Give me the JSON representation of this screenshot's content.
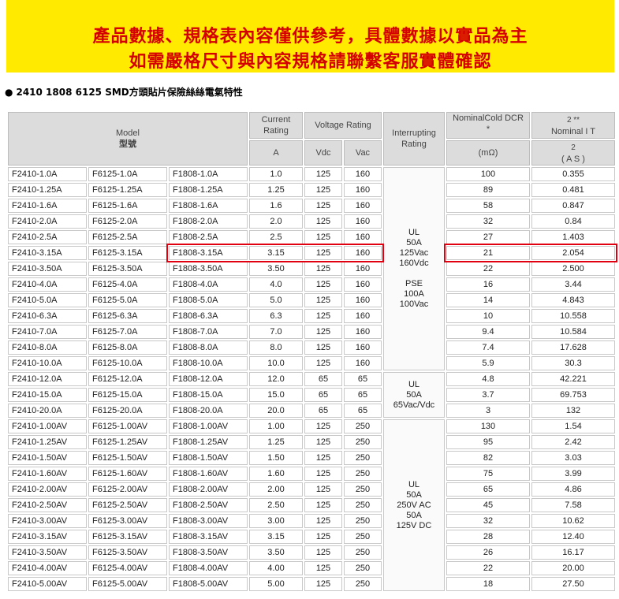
{
  "banner": {
    "line1": "產品數據、規格表內容僅供參考，具體數據以實品為主",
    "line2": "如需嚴格尺寸與內容規格請聯繫客服實體確認",
    "bg": "#ffea00",
    "color": "#d50000"
  },
  "section_title": "2410 1808 6125 SMD方頭貼片保險絲絲電氣特性",
  "header": {
    "model": "Model",
    "model_zh": "型號",
    "current_rating": "Current Rating",
    "voltage_rating": "Voltage Rating",
    "interrupting_rating": "Interrupting Rating",
    "nominal_dcr": "NominalCold DCR *",
    "nominal_i2t_top": "2 **",
    "nominal_i2t": "Nominal I T",
    "unit_a": "A",
    "unit_vdc": "Vdc",
    "unit_vac": "Vac",
    "unit_mohm": "(mΩ)",
    "unit_i2t_top": "2",
    "unit_i2t": "( A S )"
  },
  "interrupting": [
    {
      "text": "UL\n50A\n125Vac\n160Vdc\n\nPSE\n100A\n100Vac"
    },
    {
      "text": "UL\n50A\n65Vac/Vdc"
    },
    {
      "text": "UL\n50A\n250V AC\n50A\n125V DC"
    }
  ],
  "rows": [
    {
      "m2410": "F2410-1.0A",
      "m6125": "F6125-1.0A",
      "m1808": "F1808-1.0A",
      "a": "1.0",
      "vdc": "125",
      "vac": "160",
      "dcr": "100",
      "i2t": "0.355"
    },
    {
      "m2410": "F2410-1.25A",
      "m6125": "F6125-1.25A",
      "m1808": "F1808-1.25A",
      "a": "1.25",
      "vdc": "125",
      "vac": "160",
      "dcr": "89",
      "i2t": "0.481"
    },
    {
      "m2410": "F2410-1.6A",
      "m6125": "F6125-1.6A",
      "m1808": "F1808-1.6A",
      "a": "1.6",
      "vdc": "125",
      "vac": "160",
      "dcr": "58",
      "i2t": "0.847"
    },
    {
      "m2410": "F2410-2.0A",
      "m6125": "F6125-2.0A",
      "m1808": "F1808-2.0A",
      "a": "2.0",
      "vdc": "125",
      "vac": "160",
      "dcr": "32",
      "i2t": "0.84"
    },
    {
      "m2410": "F2410-2.5A",
      "m6125": "F6125-2.5A",
      "m1808": "F1808-2.5A",
      "a": "2.5",
      "vdc": "125",
      "vac": "160",
      "dcr": "27",
      "i2t": "1.403"
    },
    {
      "m2410": "F2410-3.15A",
      "m6125": "F6125-3.15A",
      "m1808": "F1808-3.15A",
      "a": "3.15",
      "vdc": "125",
      "vac": "160",
      "dcr": "21",
      "i2t": "2.054"
    },
    {
      "m2410": "F2410-3.50A",
      "m6125": "F6125-3.50A",
      "m1808": "F1808-3.50A",
      "a": "3.50",
      "vdc": "125",
      "vac": "160",
      "dcr": "22",
      "i2t": "2.500"
    },
    {
      "m2410": "F2410-4.0A",
      "m6125": "F6125-4.0A",
      "m1808": "F1808-4.0A",
      "a": "4.0",
      "vdc": "125",
      "vac": "160",
      "dcr": "16",
      "i2t": "3.44"
    },
    {
      "m2410": "F2410-5.0A",
      "m6125": "F6125-5.0A",
      "m1808": "F1808-5.0A",
      "a": "5.0",
      "vdc": "125",
      "vac": "160",
      "dcr": "14",
      "i2t": "4.843"
    },
    {
      "m2410": "F2410-6.3A",
      "m6125": "F6125-6.3A",
      "m1808": "F1808-6.3A",
      "a": "6.3",
      "vdc": "125",
      "vac": "160",
      "dcr": "10",
      "i2t": "10.558"
    },
    {
      "m2410": "F2410-7.0A",
      "m6125": "F6125-7.0A",
      "m1808": "F1808-7.0A",
      "a": "7.0",
      "vdc": "125",
      "vac": "160",
      "dcr": "9.4",
      "i2t": "10.584"
    },
    {
      "m2410": "F2410-8.0A",
      "m6125": "F6125-8.0A",
      "m1808": "F1808-8.0A",
      "a": "8.0",
      "vdc": "125",
      "vac": "160",
      "dcr": "7.4",
      "i2t": "17.628"
    },
    {
      "m2410": "F2410-10.0A",
      "m6125": "F6125-10.0A",
      "m1808": "F1808-10.0A",
      "a": "10.0",
      "vdc": "125",
      "vac": "160",
      "dcr": "5.9",
      "i2t": "30.3"
    },
    {
      "m2410": "F2410-12.0A",
      "m6125": "F6125-12.0A",
      "m1808": "F1808-12.0A",
      "a": "12.0",
      "vdc": "65",
      "vac": "65",
      "dcr": "4.8",
      "i2t": "42.221"
    },
    {
      "m2410": "F2410-15.0A",
      "m6125": "F6125-15.0A",
      "m1808": "F1808-15.0A",
      "a": "15.0",
      "vdc": "65",
      "vac": "65",
      "dcr": "3.7",
      "i2t": "69.753"
    },
    {
      "m2410": "F2410-20.0A",
      "m6125": "F6125-20.0A",
      "m1808": "F1808-20.0A",
      "a": "20.0",
      "vdc": "65",
      "vac": "65",
      "dcr": "3",
      "i2t": "132"
    },
    {
      "m2410": "F2410-1.00AV",
      "m6125": "F6125-1.00AV",
      "m1808": "F1808-1.00AV",
      "a": "1.00",
      "vdc": "125",
      "vac": "250",
      "dcr": "130",
      "i2t": "1.54"
    },
    {
      "m2410": "F2410-1.25AV",
      "m6125": "F6125-1.25AV",
      "m1808": "F1808-1.25AV",
      "a": "1.25",
      "vdc": "125",
      "vac": "250",
      "dcr": "95",
      "i2t": "2.42"
    },
    {
      "m2410": "F2410-1.50AV",
      "m6125": "F6125-1.50AV",
      "m1808": "F1808-1.50AV",
      "a": "1.50",
      "vdc": "125",
      "vac": "250",
      "dcr": "82",
      "i2t": "3.03"
    },
    {
      "m2410": "F2410-1.60AV",
      "m6125": "F6125-1.60AV",
      "m1808": "F1808-1.60AV",
      "a": "1.60",
      "vdc": "125",
      "vac": "250",
      "dcr": "75",
      "i2t": "3.99"
    },
    {
      "m2410": "F2410-2.00AV",
      "m6125": "F6125-2.00AV",
      "m1808": "F1808-2.00AV",
      "a": "2.00",
      "vdc": "125",
      "vac": "250",
      "dcr": "65",
      "i2t": "4.86"
    },
    {
      "m2410": "F2410-2.50AV",
      "m6125": "F6125-2.50AV",
      "m1808": "F1808-2.50AV",
      "a": "2.50",
      "vdc": "125",
      "vac": "250",
      "dcr": "45",
      "i2t": "7.58"
    },
    {
      "m2410": "F2410-3.00AV",
      "m6125": "F6125-3.00AV",
      "m1808": "F1808-3.00AV",
      "a": "3.00",
      "vdc": "125",
      "vac": "250",
      "dcr": "32",
      "i2t": "10.62"
    },
    {
      "m2410": "F2410-3.15AV",
      "m6125": "F6125-3.15AV",
      "m1808": "F1808-3.15AV",
      "a": "3.15",
      "vdc": "125",
      "vac": "250",
      "dcr": "28",
      "i2t": "12.40"
    },
    {
      "m2410": "F2410-3.50AV",
      "m6125": "F6125-3.50AV",
      "m1808": "F1808-3.50AV",
      "a": "3.50",
      "vdc": "125",
      "vac": "250",
      "dcr": "26",
      "i2t": "16.17"
    },
    {
      "m2410": "F2410-4.00AV",
      "m6125": "F6125-4.00AV",
      "m1808": "F1808-4.00AV",
      "a": "4.00",
      "vdc": "125",
      "vac": "250",
      "dcr": "22",
      "i2t": "20.00"
    },
    {
      "m2410": "F2410-5.00AV",
      "m6125": "F6125-5.00AV",
      "m1808": "F1808-5.00AV",
      "a": "5.00",
      "vdc": "125",
      "vac": "250",
      "dcr": "18",
      "i2t": "27.50"
    }
  ],
  "highlight_color": "#e0000f"
}
